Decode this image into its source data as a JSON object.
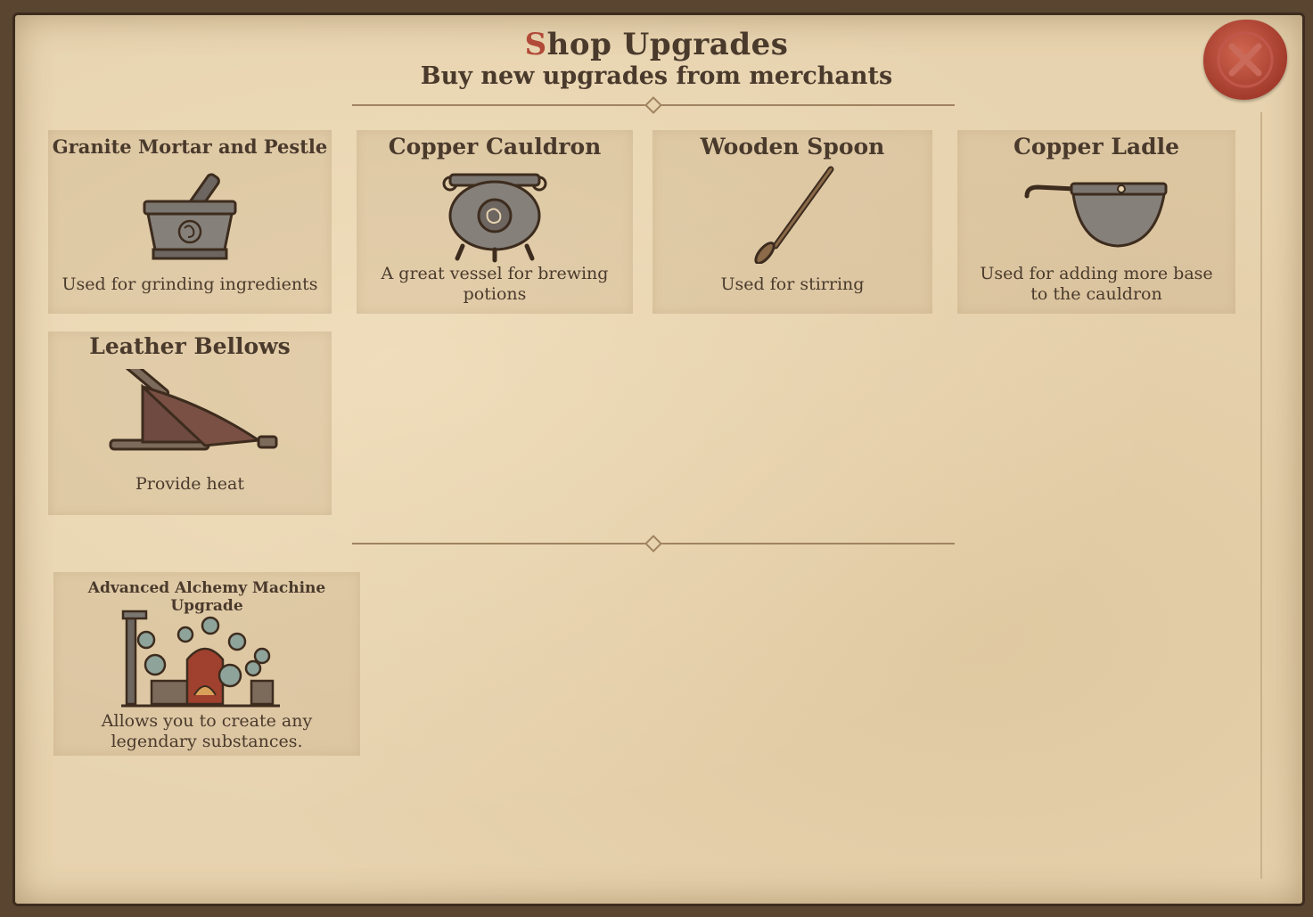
{
  "header": {
    "title_first_letter": "S",
    "title_rest": "hop Upgrades",
    "subtitle": "Buy new upgrades from merchants"
  },
  "close_button": {
    "icon": "wax-seal-x-icon",
    "color": "#a33b2c"
  },
  "upgrades": [
    {
      "name": "Granite Mortar and Pestle",
      "description": "Used for grinding ingredients",
      "icon": "mortar-pestle-icon"
    },
    {
      "name": "Copper Cauldron",
      "description": "A great vessel for brewing potions",
      "icon": "cauldron-icon"
    },
    {
      "name": "Wooden Spoon",
      "description": "Used for stirring",
      "icon": "wooden-spoon-icon"
    },
    {
      "name": "Copper Ladle",
      "description": "Used for adding more base to the cauldron",
      "icon": "ladle-icon"
    },
    {
      "name": "Leather Bellows",
      "description": "Provide heat",
      "icon": "bellows-icon"
    }
  ],
  "machine_upgrades": [
    {
      "name": "Advanced Alchemy Machine Upgrade",
      "description": "Allows you to create any legendary substances.",
      "icon": "alchemy-machine-icon"
    }
  ],
  "colors": {
    "parchment": "#e7d3af",
    "ink": "#4a3a2c",
    "accent": "#b14a38"
  }
}
